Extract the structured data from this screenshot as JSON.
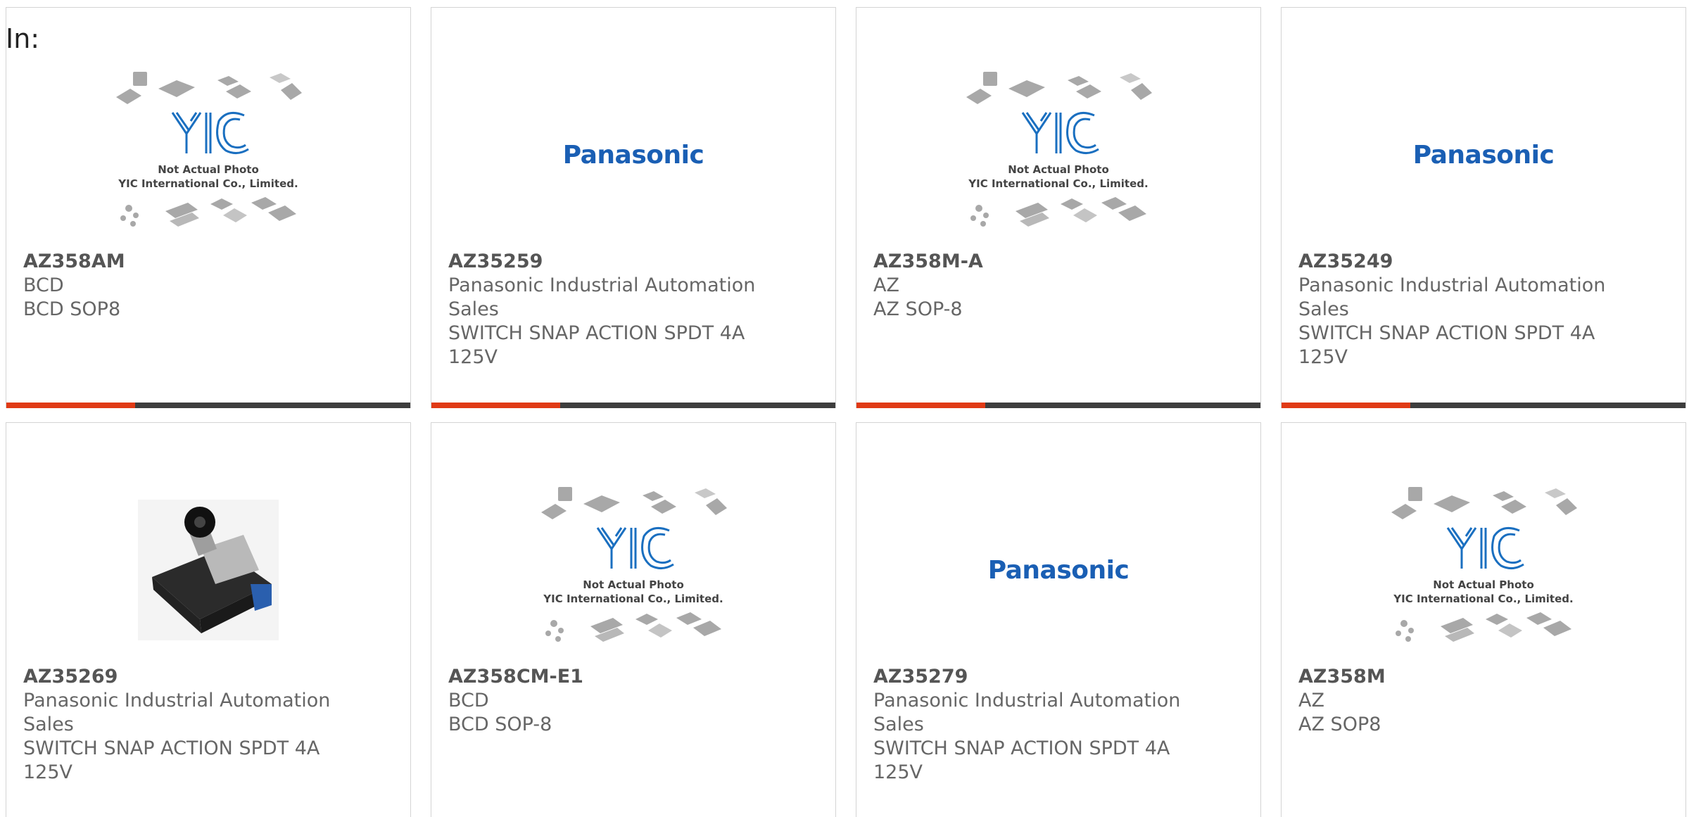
{
  "heading": "In:",
  "colors": {
    "accent": "#e03a15",
    "bar": "#3d3d3d",
    "panasonic_blue": "#1a5fb4",
    "yic_blue": "#1a6fc0"
  },
  "yic_placeholder": {
    "line1": "Not Actual Photo",
    "line2": "YIC International Co., Limited.",
    "logo": "YIC"
  },
  "panasonic_logo": "Panasonic",
  "products": [
    {
      "part": "AZ358AM",
      "maker": "BCD",
      "desc": "BCD SOP8",
      "image": "yic"
    },
    {
      "part": "AZ35259",
      "maker": "Panasonic Industrial Automation Sales",
      "desc": "SWITCH SNAP ACTION SPDT 4A 125V",
      "image": "panasonic"
    },
    {
      "part": "AZ358M-A",
      "maker": "AZ",
      "desc": "AZ SOP-8",
      "image": "yic"
    },
    {
      "part": "AZ35249",
      "maker": "Panasonic Industrial Automation Sales",
      "desc": "SWITCH SNAP ACTION SPDT 4A 125V",
      "image": "panasonic"
    },
    {
      "part": "AZ35269",
      "maker": "Panasonic Industrial Automation Sales",
      "desc": "SWITCH SNAP ACTION SPDT 4A 125V",
      "image": "switch"
    },
    {
      "part": "AZ358CM-E1",
      "maker": "BCD",
      "desc": "BCD SOP-8",
      "image": "yic"
    },
    {
      "part": "AZ35279",
      "maker": "Panasonic Industrial Automation Sales",
      "desc": "SWITCH SNAP ACTION SPDT 4A 125V",
      "image": "panasonic"
    },
    {
      "part": "AZ358M",
      "maker": "AZ",
      "desc": "AZ SOP8",
      "image": "yic"
    }
  ]
}
